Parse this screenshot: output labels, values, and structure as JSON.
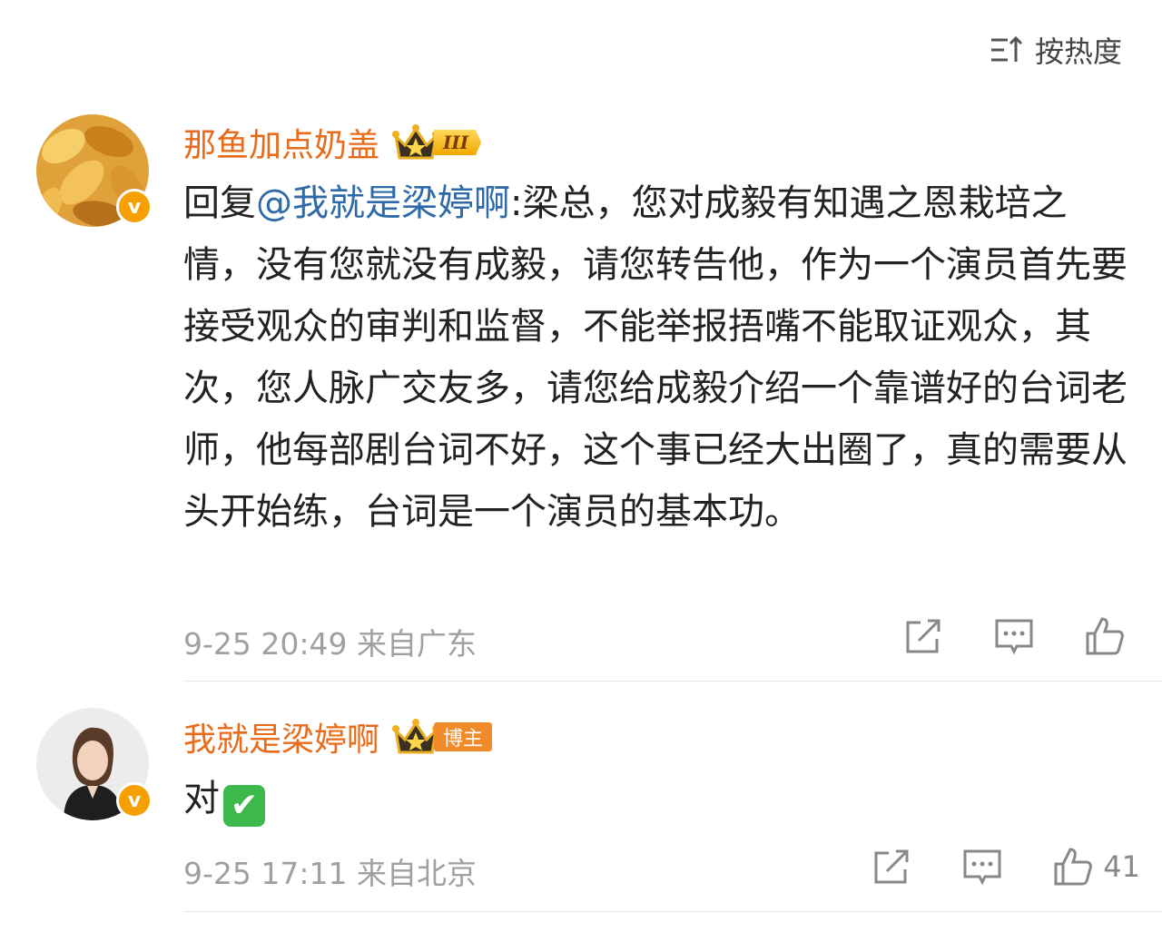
{
  "sort": {
    "label": "按热度",
    "icon": "sort-icon"
  },
  "comments": [
    {
      "username": "那鱼加点奶盖",
      "badge": "III",
      "reply_prefix": "回复",
      "mention": "@我就是梁婷啊",
      "text": ":梁总，您对成毅有知遇之恩栽培之情，没有您就没有成毅，请您转告他，作为一个演员首先要接受观众的审判和监督，不能举报捂嘴不能取证观众，其次，您人脉广交友多，请您给成毅介绍一个靠谱好的台词老师，他每部剧台词不好，这个事已经大出圈了，真的需要从头开始练，台词是一个演员的基本功。",
      "time": "9-25 20:49",
      "location": "来自广东"
    },
    {
      "username": "我就是梁婷啊",
      "badge": "博主",
      "text": "对",
      "emoji": "✔",
      "time": "9-25 17:11",
      "location": "来自北京",
      "likes": "41"
    }
  ],
  "colors": {
    "username": "#e86b1a",
    "mention": "#2e6aa8",
    "meta": "#a0a0a0"
  }
}
